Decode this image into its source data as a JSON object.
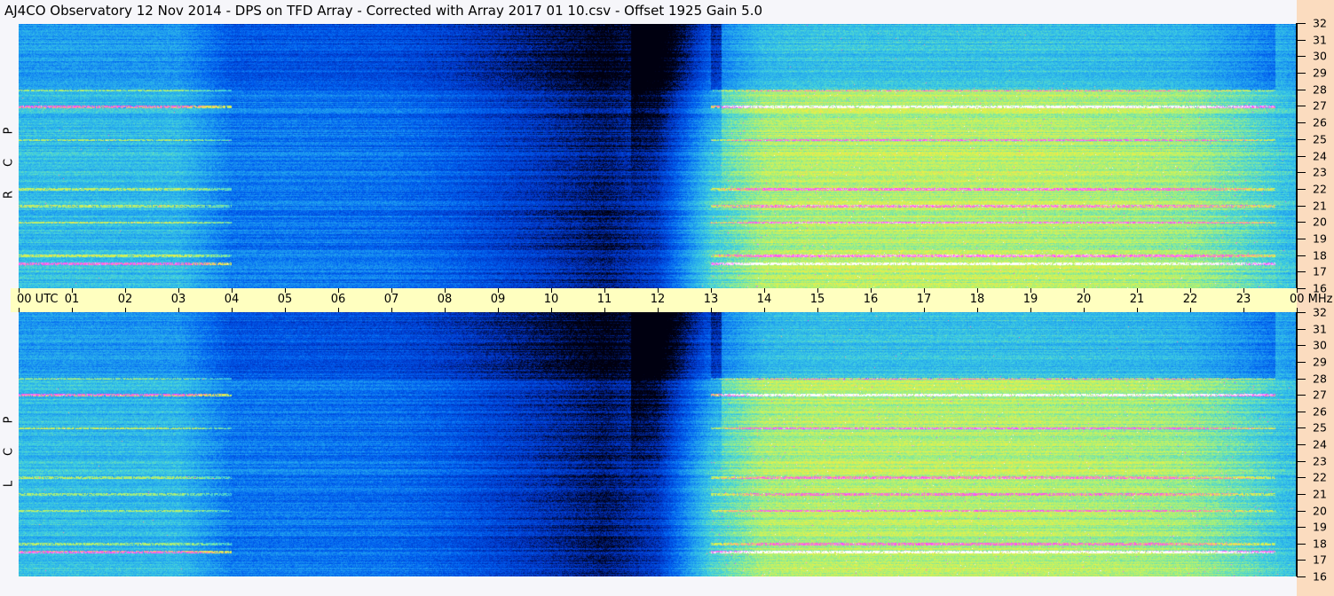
{
  "title": "AJ4CO Observatory  12 Nov 2014  -  DPS on TFD Array  -  Corrected with Array 2017 01 10.csv  -  Offset 1925  Gain 5.0",
  "chart_data": {
    "type": "heatmap",
    "title": "AJ4CO Observatory  12 Nov 2014  -  DPS on TFD Array  -  Corrected with Array 2017 01 10.csv  -  Offset 1925  Gain 5.0",
    "xlabel": "UTC",
    "ylabel": "MHz",
    "x_range": [
      0,
      24
    ],
    "y_range": [
      16,
      32
    ],
    "x_tick_labels": [
      "00",
      "01",
      "02",
      "03",
      "04",
      "05",
      "06",
      "07",
      "08",
      "09",
      "10",
      "11",
      "12",
      "13",
      "14",
      "15",
      "16",
      "17",
      "18",
      "19",
      "20",
      "21",
      "22",
      "23",
      "00"
    ],
    "y_tick_labels": [
      "32",
      "31",
      "30",
      "29",
      "28",
      "27",
      "26",
      "25",
      "24",
      "23",
      "22",
      "21",
      "20",
      "19",
      "18",
      "17",
      "16"
    ],
    "x_first_suffix": "UTC",
    "y_unit_label": "MHz",
    "panels": [
      {
        "name": "RCP",
        "letters": [
          "R",
          "C",
          "P"
        ]
      },
      {
        "name": "LCP",
        "letters": [
          "L",
          "C",
          "P"
        ]
      }
    ],
    "hourly_intensity": [
      0.45,
      0.45,
      0.44,
      0.44,
      0.3,
      0.3,
      0.29,
      0.28,
      0.24,
      0.18,
      0.12,
      0.06,
      0.15,
      0.5,
      0.64,
      0.66,
      0.66,
      0.66,
      0.66,
      0.66,
      0.65,
      0.64,
      0.62,
      0.55,
      0.45
    ],
    "interference_lines_mhz": [
      27.0,
      17.5,
      25.0,
      20.0,
      22.0,
      18.0,
      21.0,
      28.0
    ],
    "colorscale": [
      "#000010",
      "#0030c0",
      "#0060f0",
      "#20a0f0",
      "#40d0e0",
      "#a0f080",
      "#f0f040",
      "#ff40ff",
      "#ffffff"
    ]
  }
}
